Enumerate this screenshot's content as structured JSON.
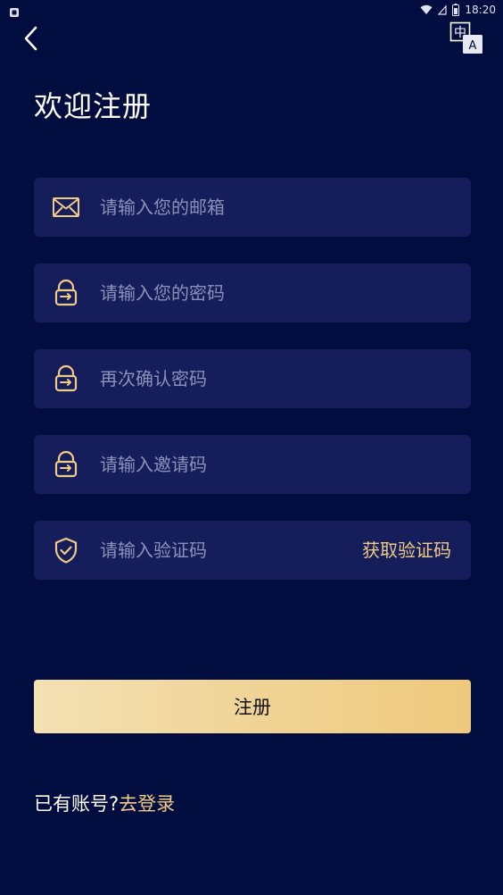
{
  "status_bar": {
    "time": "18:20"
  },
  "header": {
    "lang_icon_cn": "中",
    "lang_icon_en": "A"
  },
  "title": "欢迎注册",
  "form": {
    "email_placeholder": "请输入您的邮箱",
    "password_placeholder": "请输入您的密码",
    "confirm_placeholder": "再次确认密码",
    "invite_placeholder": "请输入邀请码",
    "code_placeholder": "请输入验证码",
    "get_code_label": "获取验证码",
    "submit_label": "注册"
  },
  "footer": {
    "prompt": "已有账号?",
    "login_link": "去登录"
  },
  "colors": {
    "background": "#010d3e",
    "field_bg": "#151e5a",
    "accent_gold": "#f0cb86",
    "placeholder": "#8b91b8"
  }
}
